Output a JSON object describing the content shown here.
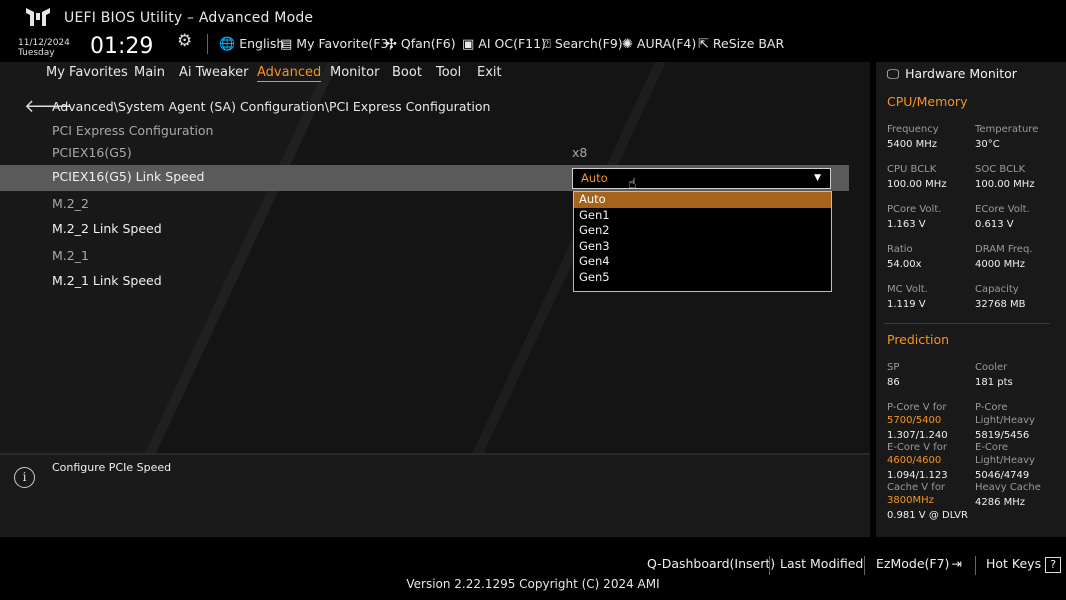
{
  "header": {
    "title": "UEFI BIOS Utility – Advanced Mode",
    "date": "11/12/2024",
    "day": "Tuesday",
    "time": "01:29",
    "items": [
      {
        "label": "English",
        "icon": "globe-icon"
      },
      {
        "label": "My Favorite(F3)",
        "icon": "favorite-icon"
      },
      {
        "label": "Qfan(F6)",
        "icon": "fan-icon"
      },
      {
        "label": "AI OC(F11)",
        "icon": "ai-chip-icon"
      },
      {
        "label": "Search(F9)",
        "icon": "search-icon"
      },
      {
        "label": "AURA(F4)",
        "icon": "aura-icon"
      },
      {
        "label": "ReSize BAR",
        "icon": "resize-bar-icon"
      }
    ]
  },
  "menu": {
    "items": [
      "My Favorites",
      "Main",
      "Ai Tweaker",
      "Advanced",
      "Monitor",
      "Boot",
      "Tool",
      "Exit"
    ],
    "active": "Advanced"
  },
  "content": {
    "breadcrumb": "Advanced\\System Agent (SA) Configuration\\PCI Express Configuration",
    "rows": [
      {
        "label": "PCI Express Configuration",
        "value": ""
      },
      {
        "label": "PCIEX16(G5)",
        "value": "x8"
      },
      {
        "label": "PCIEX16(G5) Link Speed",
        "value": "Auto"
      },
      {
        "label": "M.2_2",
        "value": ""
      },
      {
        "label": "M.2_2 Link Speed",
        "value": ""
      },
      {
        "label": "M.2_1",
        "value": ""
      },
      {
        "label": "M.2_1 Link Speed",
        "value": ""
      }
    ],
    "dropdown": {
      "options": [
        "Auto",
        "Gen1",
        "Gen2",
        "Gen3",
        "Gen4",
        "Gen5"
      ],
      "selected": "Auto"
    }
  },
  "help": {
    "text": "Configure PCIe Speed"
  },
  "hardware_monitor": {
    "title": "Hardware Monitor",
    "cpu_memory": {
      "heading": "CPU/Memory",
      "frequency_label": "Frequency",
      "frequency": "5400 MHz",
      "temperature_label": "Temperature",
      "temperature": "30°C",
      "cpu_bclk_label": "CPU BCLK",
      "cpu_bclk": "100.00 MHz",
      "soc_bclk_label": "SOC BCLK",
      "soc_bclk": "100.00 MHz",
      "pcore_volt_label": "PCore Volt.",
      "pcore_volt": "1.163 V",
      "ecore_volt_label": "ECore Volt.",
      "ecore_volt": "0.613 V",
      "ratio_label": "Ratio",
      "ratio": "54.00x",
      "dram_freq_label": "DRAM Freq.",
      "dram_freq": "4000 MHz",
      "mc_volt_label": "MC Volt.",
      "mc_volt": "1.119 V",
      "capacity_label": "Capacity",
      "capacity": "32768 MB"
    },
    "prediction": {
      "heading": "Prediction",
      "sp_label": "SP",
      "sp": "86",
      "cooler_label": "Cooler",
      "cooler": "181 pts",
      "pcore_v_label": "P-Core V for",
      "pcore_v_freq": "5700/5400",
      "pcore_v": "1.307/1.240",
      "pcore_lh_label": "P-Core Light/Heavy",
      "pcore_lh": "5819/5456",
      "ecore_v_label": "E-Core V for",
      "ecore_v_freq": "4600/4600",
      "ecore_v": "1.094/1.123",
      "ecore_lh_label": "E-Core Light/Heavy",
      "ecore_lh": "5046/4749",
      "cache_v_label": "Cache V for",
      "cache_v_freq": "3800MHz",
      "cache_v": "0.981 V @ DLVR",
      "heavy_cache_label": "Heavy Cache",
      "heavy_cache": "4286 MHz"
    }
  },
  "footer": {
    "q_dashboard": "Q-Dashboard(Insert)",
    "last_modified": "Last Modified",
    "ezmode": "EzMode(F7)",
    "hotkeys": "Hot Keys",
    "hotkeys_key": "?",
    "version": "Version 2.22.1295 Copyright (C) 2024 AMI"
  },
  "colors": {
    "accent": "#f7941d",
    "selected_option": "#a8631a",
    "highlight_row": "#5a5a5a"
  }
}
